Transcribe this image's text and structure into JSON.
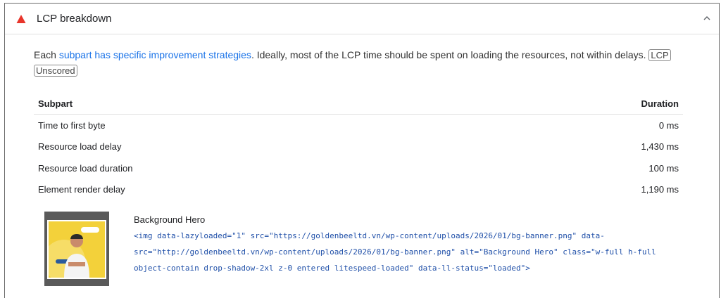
{
  "header": {
    "title": "LCP breakdown",
    "status_color": "#e8352b",
    "status_icon": "warning-triangle",
    "toggle_icon": "chevron-up"
  },
  "description": {
    "prefix": "Each ",
    "link_text": "subpart has specific improvement strategies",
    "suffix": ". Ideally, most of the LCP time should be spent on loading the resources, not within delays.",
    "badges": [
      "LCP",
      "Unscored"
    ]
  },
  "table": {
    "headers": {
      "subpart": "Subpart",
      "duration": "Duration"
    },
    "rows": [
      {
        "subpart": "Time to first byte",
        "duration": "0 ms"
      },
      {
        "subpart": "Resource load delay",
        "duration": "1,430 ms"
      },
      {
        "subpart": "Resource load duration",
        "duration": "100 ms"
      },
      {
        "subpart": "Element render delay",
        "duration": "1,190 ms"
      }
    ]
  },
  "node": {
    "label": "Background Hero",
    "snippet": "<img data-lazyloaded=\"1\" src=\"https://goldenbeeltd.vn/wp-content/uploads/2026/01/bg-banner.png\" data-\nsrc=\"http://goldenbeeltd.vn/wp-content/uploads/2026/01/bg-banner.png\" alt=\"Background Hero\" class=\"w-full h-full\nobject-contain drop-shadow-2xl z-0 entered litespeed-loaded\" data-ll-status=\"loaded\">",
    "thumbnail_icon": "hero-banner-thumbnail",
    "link_color": "#1a73e8"
  }
}
